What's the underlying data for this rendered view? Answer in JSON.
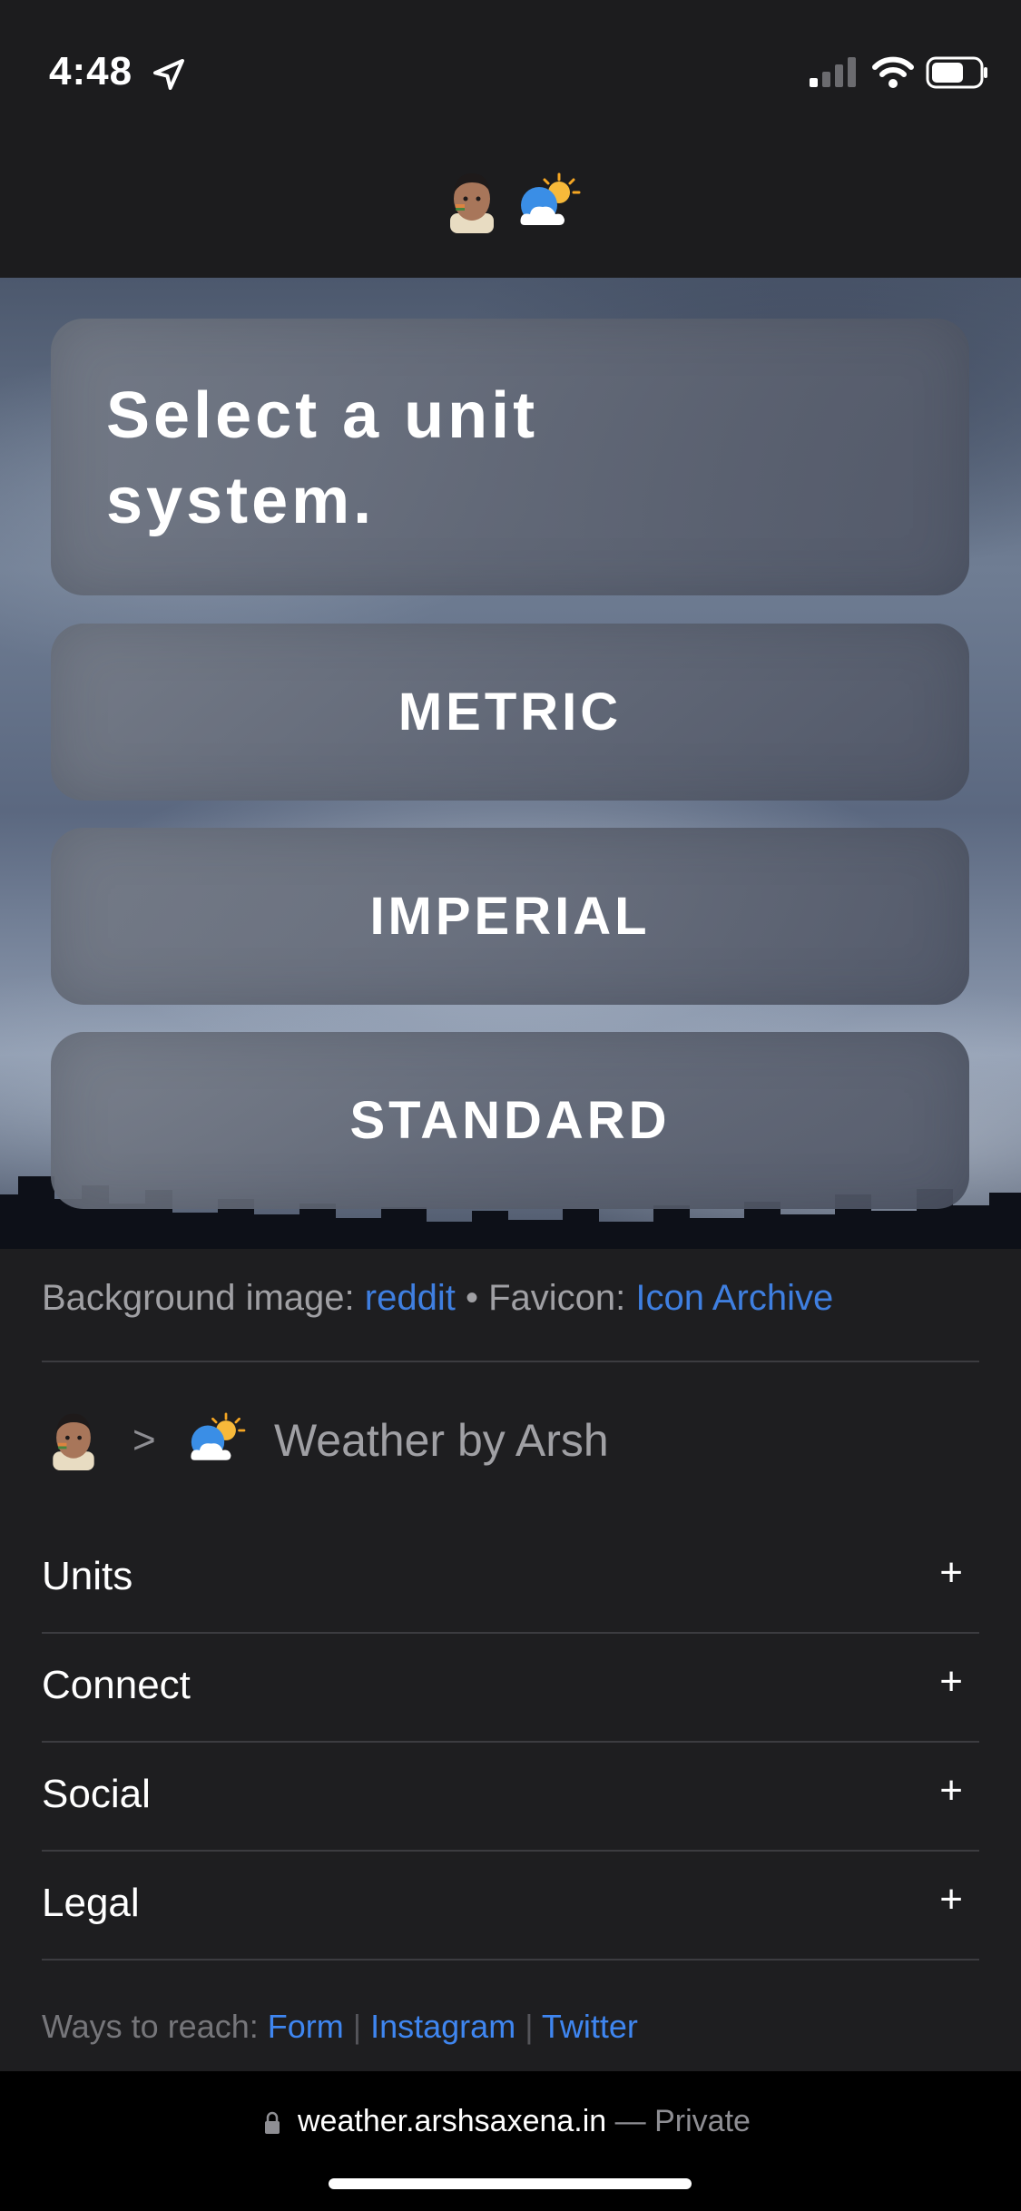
{
  "status_bar": {
    "time": "4:48"
  },
  "hero": {
    "title": "Select a unit system.",
    "buttons": {
      "metric": "METRIC",
      "imperial": "IMPERIAL",
      "standard": "STANDARD"
    }
  },
  "credits": {
    "bg_prefix": "Background image: ",
    "bg_link": "reddit",
    "bullet": " • ",
    "favicon_prefix": "Favicon: ",
    "favicon_link": "Icon Archive"
  },
  "breadcrumb": {
    "chevron": ">",
    "site_name": "Weather by Arsh"
  },
  "accordion": [
    {
      "label": "Units",
      "icon": "+"
    },
    {
      "label": "Connect",
      "icon": "+"
    },
    {
      "label": "Social",
      "icon": "+"
    },
    {
      "label": "Legal",
      "icon": "+"
    }
  ],
  "reach": {
    "prefix": "Ways to reach: ",
    "links": [
      "Form",
      "Instagram",
      "Twitter"
    ],
    "separator": " | "
  },
  "url_bar": {
    "domain": "weather.arshsaxena.in",
    "suffix": " — Private"
  },
  "colors": {
    "link": "#3f7fe0",
    "background": "#1e1e20",
    "url_bar": "#000000"
  }
}
